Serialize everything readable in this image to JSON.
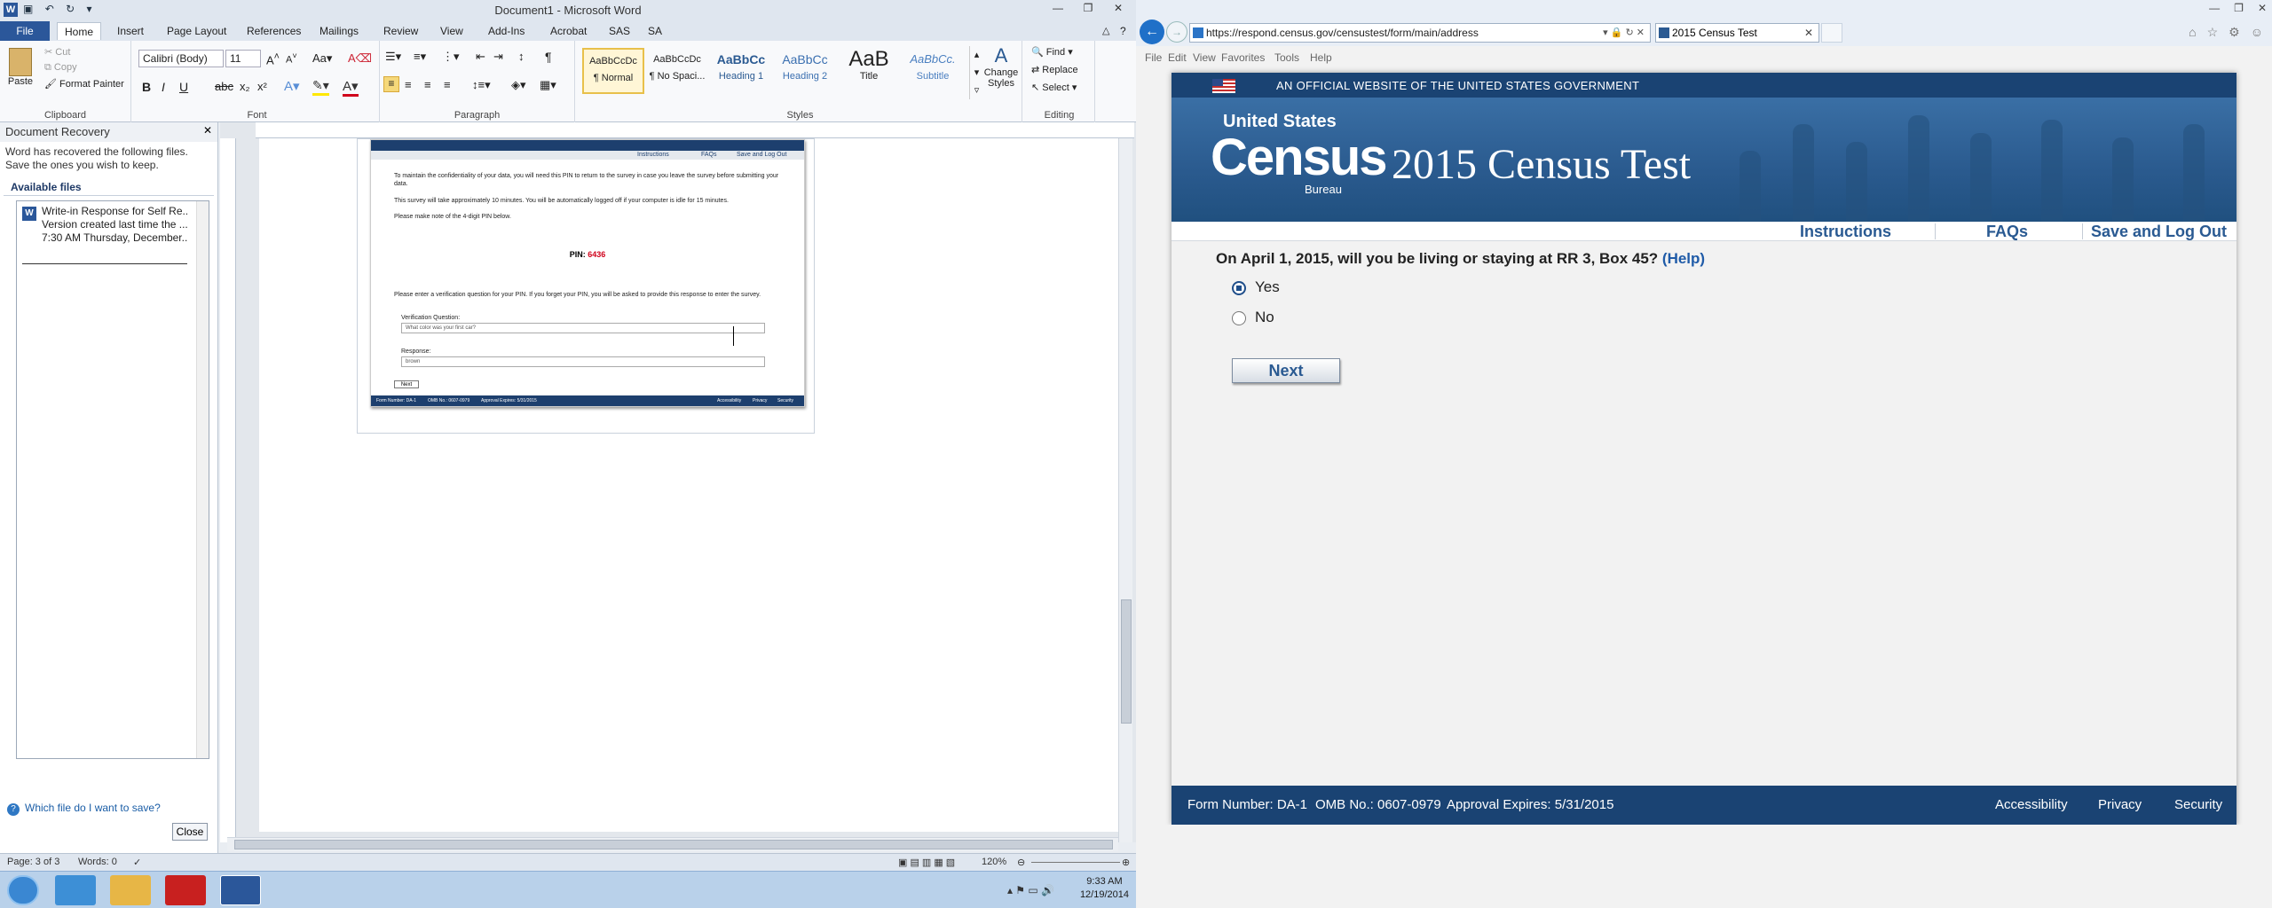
{
  "word": {
    "window_title": "Document1 - Microsoft Word",
    "tabs": [
      "File",
      "Home",
      "Insert",
      "Page Layout",
      "References",
      "Mailings",
      "Review",
      "View",
      "Add-Ins",
      "Acrobat",
      "SAS",
      "SA"
    ],
    "clipboard": {
      "paste": "Paste",
      "cut": "Cut",
      "copy": "Copy",
      "format_painter": "Format Painter",
      "label": "Clipboard"
    },
    "font": {
      "family": "Calibri (Body)",
      "size": "11",
      "label": "Font"
    },
    "paragraph_label": "Paragraph",
    "styles": {
      "items": [
        {
          "sample": "AaBbCcDc",
          "name": "¶ Normal"
        },
        {
          "sample": "AaBbCcDc",
          "name": "¶ No Spaci..."
        },
        {
          "sample": "AaBbCc",
          "name": "Heading 1"
        },
        {
          "sample": "AaBbCc",
          "name": "Heading 2"
        },
        {
          "sample": "AaB",
          "name": "Title"
        },
        {
          "sample": "AaBbCc.",
          "name": "Subtitle"
        }
      ],
      "change_styles": "Change Styles",
      "label": "Styles"
    },
    "editing": {
      "find": "Find",
      "replace": "Replace",
      "select": "Select",
      "label": "Editing"
    },
    "recovery": {
      "header": "Document Recovery",
      "message": "Word has recovered the following files.  Save the ones you wish to keep.",
      "available": "Available files",
      "file_line1": "Write-in Response for Self Re...",
      "file_line2": "Version created last time the ...",
      "file_line3": "7:30 AM Thursday, December...",
      "help_link": "Which file do I want to save?",
      "close": "Close"
    },
    "doc_snapshot": {
      "nav": [
        "Instructions",
        "FAQs",
        "Save and Log Out"
      ],
      "p1": "To maintain the confidentiality of your data, you will need this PIN to return to the survey in case you leave the survey before submitting your data.",
      "p2": "This survey will take approximately 10 minutes. You will be automatically logged off if your computer is idle for 15 minutes.",
      "p3": "Please make note of the 4-digit PIN below.",
      "pin_label": "PIN:",
      "pin_value": "6436",
      "p4": "Please enter a verification question for your PIN. If you forget your PIN, you will be asked to provide this response to enter the survey.",
      "vq_label": "Verification Question:",
      "vq_value": "What color was your first car?",
      "resp_label": "Response:",
      "resp_value": "brown",
      "next": "Next",
      "footer": [
        "Form Number: DA-1",
        "OMB No.: 0607-0979",
        "Approval Expires: 5/31/2015",
        "Accessibility",
        "Privacy",
        "Security"
      ]
    },
    "status": {
      "page": "Page: 3 of 3",
      "words": "Words: 0",
      "zoom": "120%"
    },
    "clock": {
      "time": "9:33 AM",
      "date": "12/19/2014"
    }
  },
  "ie": {
    "url": "https://respond.census.gov/censustest/form/main/address",
    "tab_title": "2015 Census Test",
    "menu": [
      "File",
      "Edit",
      "View",
      "Favorites",
      "Tools",
      "Help"
    ],
    "site": {
      "gov_banner": "AN OFFICIAL WEBSITE OF THE UNITED STATES GOVERNMENT",
      "logo_top": "United States",
      "logo_main": "Census",
      "logo_bottom": "Bureau",
      "title": "2015 Census Test",
      "nav": [
        "Instructions",
        "FAQs",
        "Save and Log Out"
      ],
      "question": "On April 1, 2015, will you be living or staying at RR 3, Box 45?",
      "help": "(Help)",
      "options": [
        {
          "label": "Yes",
          "selected": true
        },
        {
          "label": "No",
          "selected": false
        }
      ],
      "next": "Next",
      "footer": {
        "form": "Form Number: DA-1",
        "omb": "OMB No.: 0607-0979",
        "expires": "Approval Expires: 5/31/2015",
        "links": [
          "Accessibility",
          "Privacy",
          "Security"
        ]
      }
    }
  },
  "colors": {
    "word_blue": "#2b579a",
    "census_navy": "#1a4373",
    "link_blue": "#2a5a92",
    "pin_red": "#d0021b"
  }
}
